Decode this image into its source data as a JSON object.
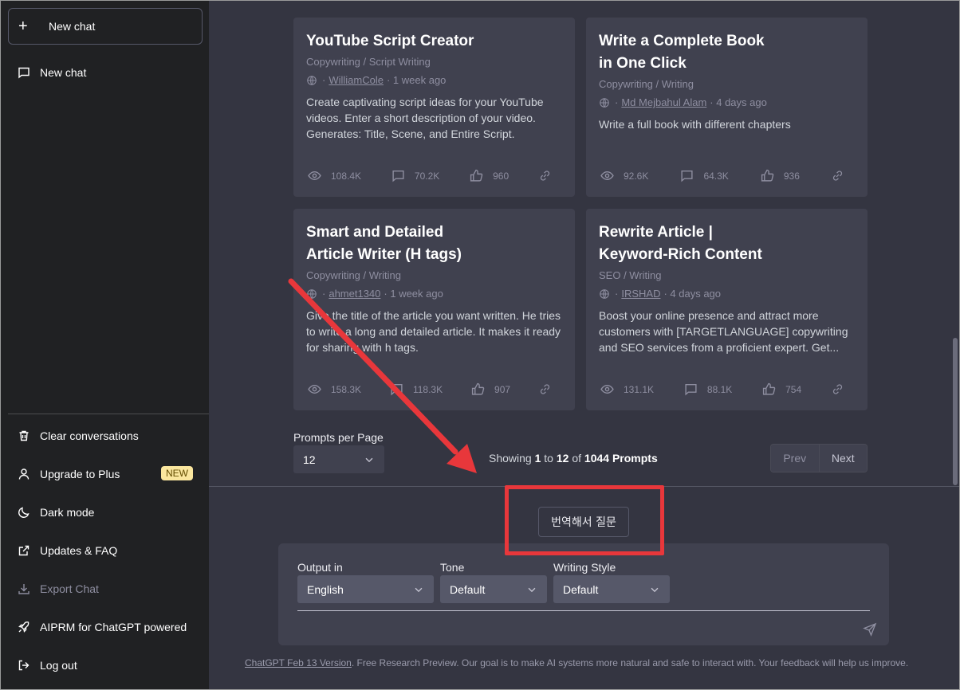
{
  "sidebar": {
    "new_chat_button": "New chat",
    "chats": [
      {
        "label": "New chat"
      }
    ],
    "menu": [
      {
        "label": "Clear conversations",
        "icon": "trash-icon"
      },
      {
        "label": "Upgrade to Plus",
        "icon": "user-icon",
        "badge": "NEW"
      },
      {
        "label": "Dark mode",
        "icon": "moon-icon"
      },
      {
        "label": "Updates & FAQ",
        "icon": "external-link-icon"
      },
      {
        "label": "Export Chat",
        "icon": "download-icon",
        "disabled": true
      },
      {
        "label": "AIPRM for ChatGPT powered",
        "icon": "rocket-icon"
      },
      {
        "label": "Log out",
        "icon": "logout-icon"
      }
    ]
  },
  "cards": [
    {
      "title_line1": "YouTube Script Creator",
      "title_line2": "",
      "category": "Copywriting / Script Writing",
      "author": "WilliamCole",
      "time": "· 1 week ago",
      "description": "Create captivating script ideas for your YouTube videos. Enter a short description of your video. Generates: Title, Scene, and Entire Script.",
      "views": "108.4K",
      "comments": "70.2K",
      "likes": "960"
    },
    {
      "title_line1": "Write a Complete Book",
      "title_line2": "in One Click",
      "category": "Copywriting / Writing",
      "author": "Md Mejbahul Alam",
      "time": "· 4 days ago",
      "description": "Write a full book with different chapters",
      "views": "92.6K",
      "comments": "64.3K",
      "likes": "936"
    },
    {
      "title_line1": "Smart and Detailed",
      "title_line2": "Article Writer (H tags)",
      "category": "Copywriting / Writing",
      "author": "ahmet1340",
      "time": "· 1 week ago",
      "description": "Give the title of the article you want written. He tries to write a long and detailed article. It makes it ready for sharing with h tags.",
      "views": "158.3K",
      "comments": "118.3K",
      "likes": "907"
    },
    {
      "title_line1": "Rewrite Article |",
      "title_line2": "Keyword-Rich Content",
      "category": "SEO / Writing",
      "author": "IRSHAD",
      "time": "· 4 days ago",
      "description": "Boost your online presence and attract more customers with [TARGETLANGUAGE] copywriting and SEO services from a proficient expert. Get...",
      "views": "131.1K",
      "comments": "88.1K",
      "likes": "754"
    }
  ],
  "pagination": {
    "per_page_label": "Prompts per Page",
    "per_page_value": "12",
    "showing_prefix": "Showing",
    "from": "1",
    "to_word": "to",
    "to": "12",
    "of_word": "of",
    "total": "1044 Prompts",
    "prev": "Prev",
    "next": "Next"
  },
  "translate_button": "번역해서 질문",
  "input": {
    "output_label": "Output in",
    "output_value": "English",
    "tone_label": "Tone",
    "tone_value": "Default",
    "style_label": "Writing Style",
    "style_value": "Default"
  },
  "footer": {
    "version_link": "ChatGPT Feb 13 Version",
    "text": ". Free Research Preview. Our goal is to make AI systems more natural and safe to interact with. Your feedback will help us improve."
  },
  "colors": {
    "sidebar_bg": "#202123",
    "main_bg": "#343541",
    "card_bg": "#40414f",
    "annotation_red": "#e8373b",
    "badge_bg": "#fae69e"
  }
}
